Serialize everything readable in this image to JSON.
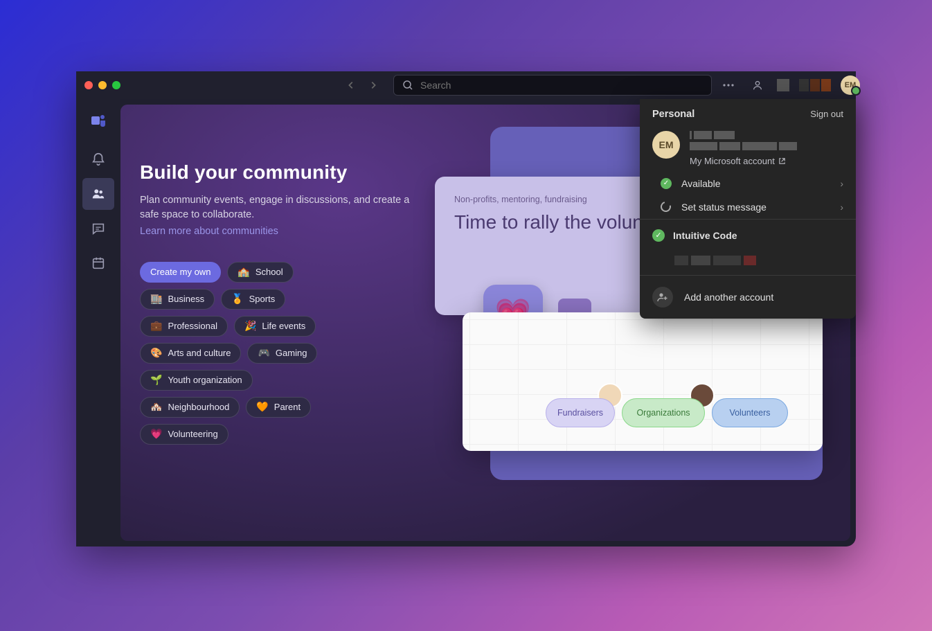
{
  "titlebar": {
    "search_placeholder": "Search",
    "avatar_initials": "EM"
  },
  "community": {
    "title": "Build your community",
    "description": "Plan community events, engage in discussions, and create a safe space to collaborate.",
    "learn_more": "Learn more about communities",
    "chips": {
      "create": "Create my own",
      "school": "School",
      "business": "Business",
      "sports": "Sports",
      "professional": "Professional",
      "life_events": "Life events",
      "arts": "Arts and culture",
      "gaming": "Gaming",
      "youth": "Youth organization",
      "neighbourhood": "Neighbourhood",
      "parent": "Parent",
      "volunteering": "Volunteering"
    }
  },
  "promo": {
    "tag": "Non-profits, mentoring, fundraising",
    "title": "Time to rally the volunteers",
    "nodes": {
      "fundraisers": "Fundraisers",
      "organizations": "Organizations",
      "volunteers": "Volunteers"
    }
  },
  "account": {
    "header": "Personal",
    "sign_out": "Sign out",
    "avatar_initials": "EM",
    "my_account": "My Microsoft account",
    "status_available": "Available",
    "set_status": "Set status message",
    "org_name": "Intuitive Code",
    "add_account": "Add another account"
  }
}
